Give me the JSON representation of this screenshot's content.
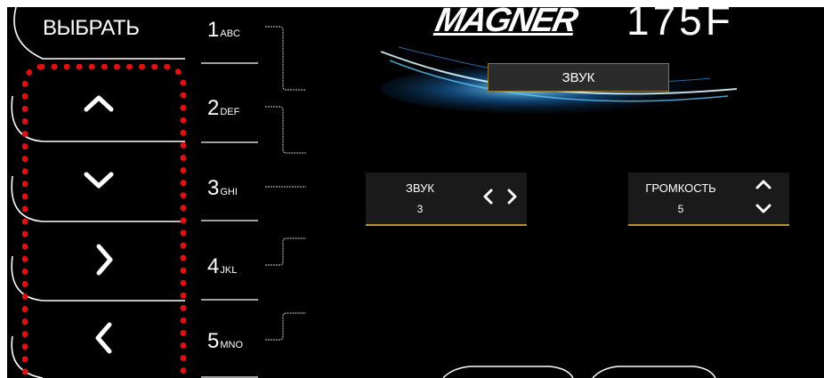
{
  "left_panel": {
    "select_label": "ВЫБРАТЬ",
    "nav_buttons": [
      "up-chevron-icon",
      "down-chevron-icon",
      "right-chevron-icon",
      "left-chevron-icon"
    ]
  },
  "keypad": [
    {
      "digit": "1",
      "letters": "ABC"
    },
    {
      "digit": "2",
      "letters": "DEF"
    },
    {
      "digit": "3",
      "letters": "GHI"
    },
    {
      "digit": "4",
      "letters": "JKL"
    },
    {
      "digit": "5",
      "letters": "MNO"
    }
  ],
  "header": {
    "brand": "MAGNER",
    "model": "175F"
  },
  "screen_title": "ЗВУК",
  "sound_control": {
    "label": "ЗВУК",
    "value": "3"
  },
  "volume_control": {
    "label": "ГРОМКОСТЬ",
    "value": "5"
  },
  "colors": {
    "background": "#000000",
    "accent_gold": "#b9922d",
    "highlight_red": "#e01010",
    "panel_bg": "#1a1a1a"
  }
}
